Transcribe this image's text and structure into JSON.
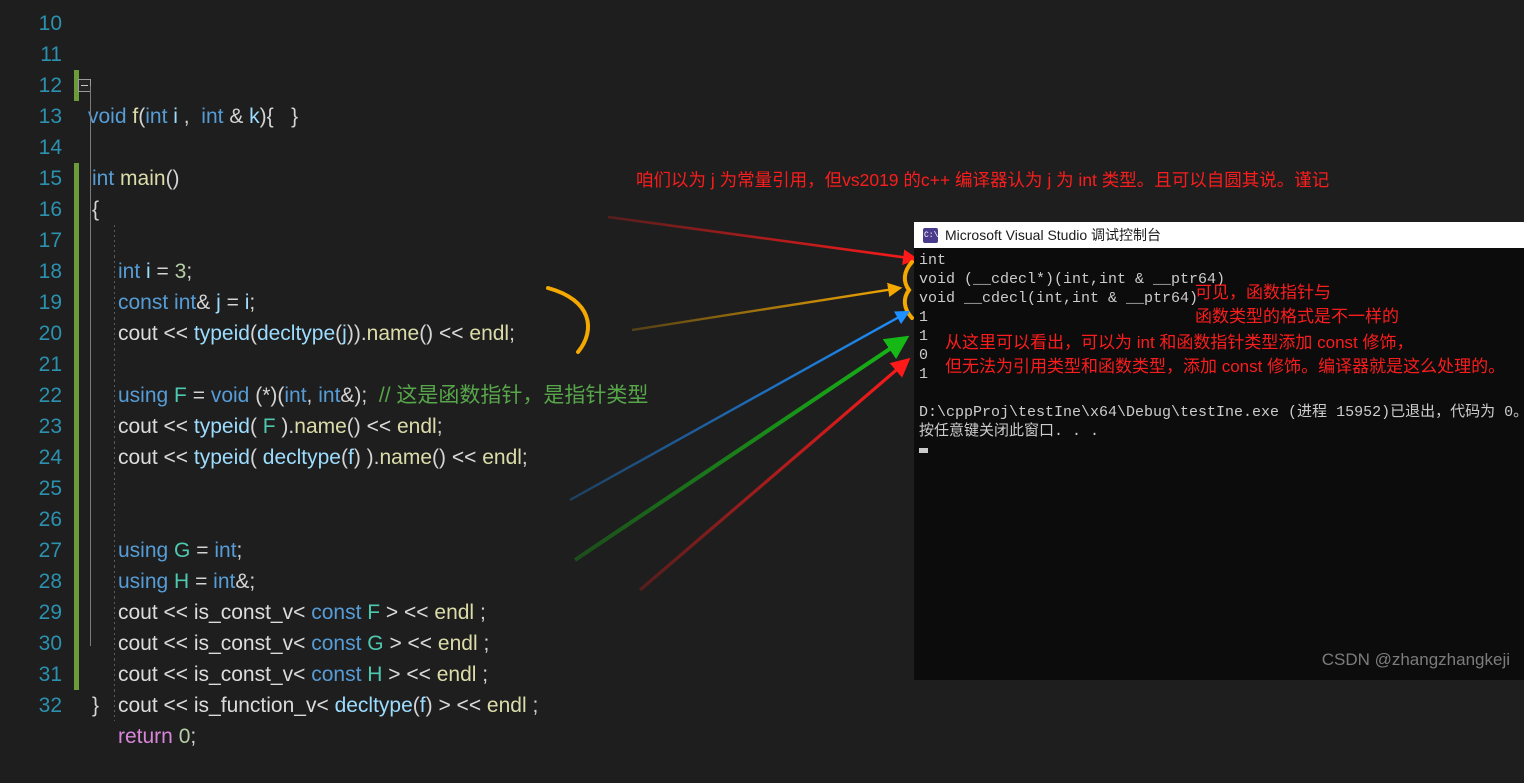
{
  "editor": {
    "name": "visual-studio-code-editor",
    "lines": [
      {
        "num": "10",
        "text": "",
        "partial": true
      },
      {
        "num": "11",
        "text": "void f(int i ,  int & k){   }"
      },
      {
        "num": "12",
        "text": ""
      },
      {
        "num": "13",
        "text": "int main()"
      },
      {
        "num": "14",
        "text": "{"
      },
      {
        "num": "15",
        "text": "int i = 3;"
      },
      {
        "num": "16",
        "text": "const int& j = i;"
      },
      {
        "num": "17",
        "text": "cout << typeid(decltype(j)).name() << endl;"
      },
      {
        "num": "18",
        "text": ""
      },
      {
        "num": "19",
        "text": "using F = void (*)(int, int&);  // 这是函数指针，是指针类型"
      },
      {
        "num": "20",
        "text": "cout << typeid( F ).name() << endl;"
      },
      {
        "num": "21",
        "text": "cout << typeid( decltype(f) ).name() << endl;"
      },
      {
        "num": "22",
        "text": ""
      },
      {
        "num": "23",
        "text": ""
      },
      {
        "num": "24",
        "text": "using G = int;"
      },
      {
        "num": "25",
        "text": "using H = int&;"
      },
      {
        "num": "26",
        "text": "cout << is_const_v< const F > << endl ;"
      },
      {
        "num": "27",
        "text": "cout << is_const_v< const G > << endl ;"
      },
      {
        "num": "28",
        "text": "cout << is_const_v< const H > << endl ;"
      },
      {
        "num": "29",
        "text": "cout << is_function_v< decltype(f) > << endl ;"
      },
      {
        "num": "30",
        "text": "return 0;"
      },
      {
        "num": "31",
        "text": "}"
      },
      {
        "num": "32",
        "text": "",
        "partial": true
      }
    ],
    "comment_line19": "// 这是函数指针，是指针类型"
  },
  "console": {
    "title": "Microsoft Visual Studio 调试控制台",
    "icon": "console-window-icon",
    "output": [
      "int",
      "void (__cdecl*)(int,int & __ptr64)",
      "void __cdecl(int,int & __ptr64)",
      "1",
      "1",
      "0",
      "1",
      "",
      "D:\\cppProj\\testIne\\x64\\Debug\\testIne.exe (进程 15952)已退出，代码为 0。",
      "按任意键关闭此窗口. . ."
    ]
  },
  "annotations": {
    "top": "咱们以为 j 为常量引用，但vs2019 的c++ 编译器认为 j 为 int 类型。且可以自圆其说。谨记",
    "pointer_note_line1": "可见，函数指针与",
    "pointer_note_line2": "函数类型的格式是不一样的",
    "const_note_line1": "从这里可以看出，可以为 int 和函数指针类型添加 const 修饰，",
    "const_note_line2": "但无法为引用类型和函数类型，添加 const 修饰。编译器就是这么处理的。"
  },
  "colors": {
    "annotation_red": "#fb1d1d",
    "arrow_red": "#ff1a1a",
    "arrow_orange": "#f5a800",
    "arrow_blue": "#1e90ff",
    "arrow_green": "#16b816",
    "editor_bg": "#1e1e1e",
    "console_bg": "#0c0c0c",
    "linenum": "#2b91af"
  },
  "watermark": "CSDN @zhangzhangkeji"
}
